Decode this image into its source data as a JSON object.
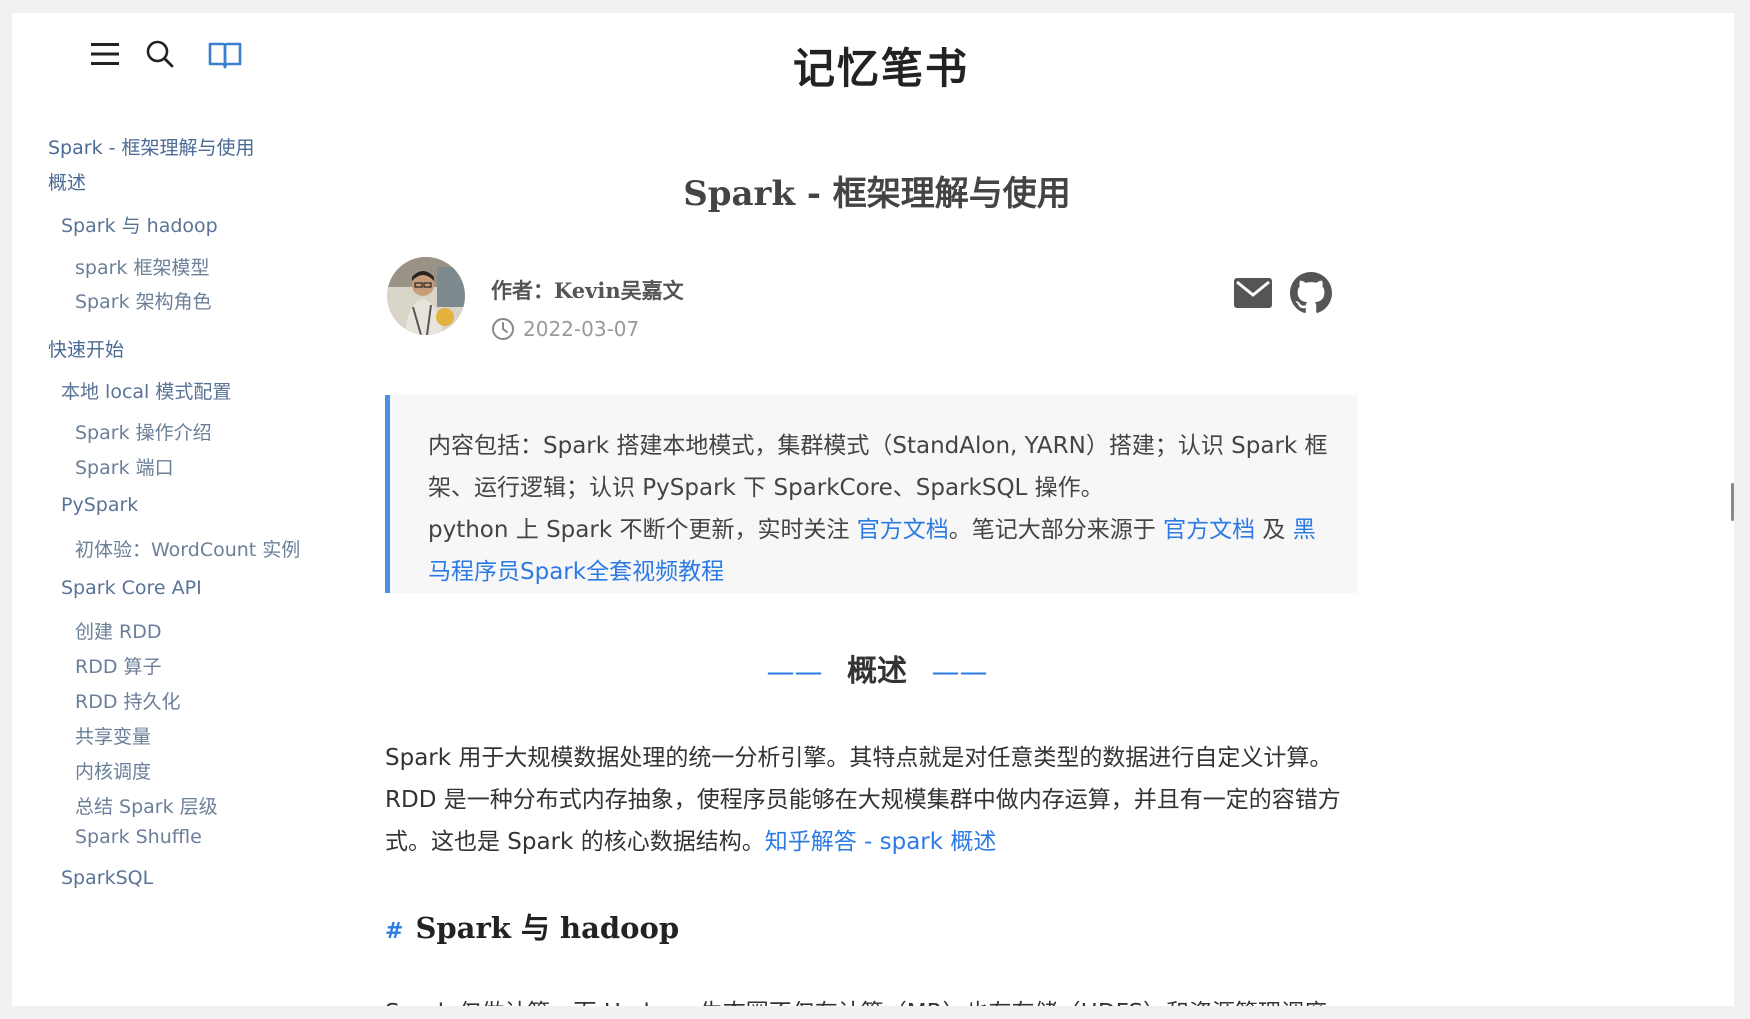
{
  "header": {
    "site_title": "记忆笔书",
    "icons": [
      "menu-icon",
      "search-icon",
      "book-icon"
    ]
  },
  "toc": {
    "items": [
      {
        "label": "Spark - 框架理解与使用",
        "level": 1
      },
      {
        "label": "概述",
        "level": 1
      },
      {
        "label": "Spark 与 hadoop",
        "level": 2
      },
      {
        "label": "spark 框架模型",
        "level": 3
      },
      {
        "label": "Spark 架构角色",
        "level": 3
      },
      {
        "label": "快速开始",
        "level": 1
      },
      {
        "label": "本地 local 模式配置",
        "level": 2
      },
      {
        "label": "Spark 操作介绍",
        "level": 3
      },
      {
        "label": "Spark 端口",
        "level": 3
      },
      {
        "label": "PySpark",
        "level": 2
      },
      {
        "label": "初体验：WordCount 实例",
        "level": 3
      },
      {
        "label": "Spark Core API",
        "level": 2
      },
      {
        "label": "创建 RDD",
        "level": 3
      },
      {
        "label": "RDD 算子",
        "level": 3
      },
      {
        "label": "RDD 持久化",
        "level": 3
      },
      {
        "label": "共享变量",
        "level": 3
      },
      {
        "label": "内核调度",
        "level": 3
      },
      {
        "label": "总结 Spark 层级",
        "level": 3
      },
      {
        "label": "Spark Shuffle",
        "level": 3
      },
      {
        "label": "SparkSQL",
        "level": 2
      }
    ]
  },
  "post": {
    "title": "Spark - 框架理解与使用",
    "author": "作者：Kevin吴嘉文",
    "date": "2022-03-07",
    "social_icons": [
      "mail-icon",
      "github-icon"
    ]
  },
  "summary": {
    "line1": "内容包括：Spark 搭建本地模式，集群模式（StandAlon, YARN）搭建；认识 Spark 框架、运行逻辑；认识 PySpark 下 SparkCore、SparkSQL 操作。",
    "line2_prefix": "python 上 Spark 不断个更新，实时关注 ",
    "link1": "官方文档",
    "line2_mid": "。笔记大部分来源于 ",
    "link2": "官方文档",
    "line2_and": " 及 ",
    "link3": "黑马程序员Spark全套视频教程"
  },
  "section": {
    "heading": "概述",
    "dash_left": "——",
    "dash_right": "——"
  },
  "overview": {
    "text": "Spark 用于大规模数据处理的统一分析引擎。其特点就是对任意类型的数据进行自定义计算。RDD 是一种分布式内存抽象，使程序员能够在大规模集群中做内存运算，并且有一定的容错方式。这也是 Spark 的核心数据结构。",
    "link": "知乎解答 - spark 概述"
  },
  "subsection": {
    "hash": "#",
    "heading": "Spark 与 hadoop",
    "partial_text": "Spark 仅做计算，而 Hadoop 生态圈不仅有计算（MR）也有存储（HDFS）和资源管理调度"
  },
  "colors": {
    "accent": "#2c7be5",
    "toc_link": "#4a6a95",
    "quote_bg": "#f7f7f7"
  }
}
